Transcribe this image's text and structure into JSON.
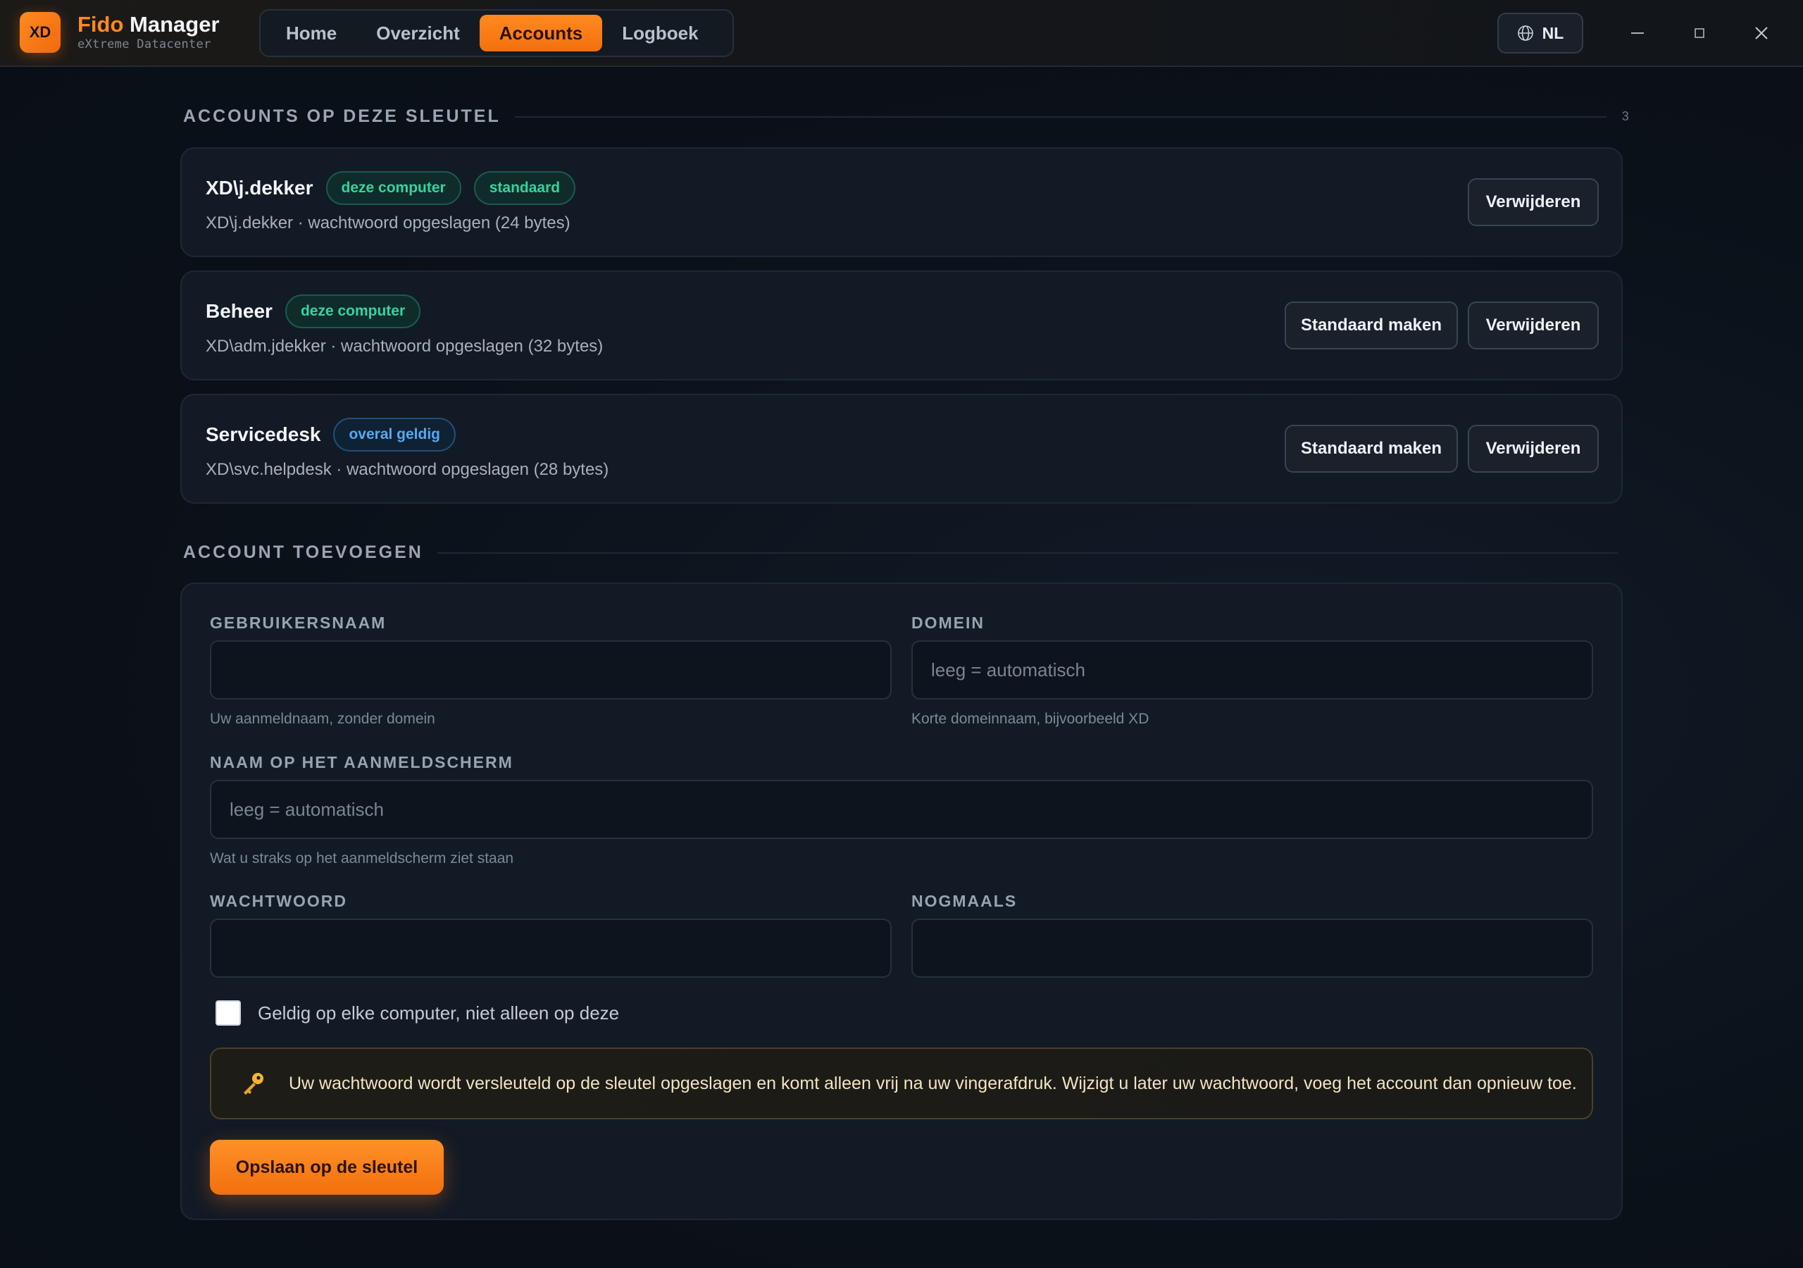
{
  "app": {
    "logo_text": "XD",
    "title_accent": "Fido",
    "title_main": "Manager",
    "subtitle": "eXtreme Datacenter"
  },
  "nav": {
    "tabs": [
      {
        "label": "Home",
        "active": false
      },
      {
        "label": "Overzicht",
        "active": false
      },
      {
        "label": "Accounts",
        "active": true
      },
      {
        "label": "Logboek",
        "active": false
      }
    ]
  },
  "language": {
    "code": "NL",
    "icon": "globe-icon"
  },
  "window_controls": [
    "minimize-icon",
    "maximize-icon",
    "close-icon"
  ],
  "accounts_section": {
    "title": "ACCOUNTS OP DEZE SLEUTEL",
    "count": "3",
    "accounts": [
      {
        "name": "XD\\j.dekker",
        "badges": [
          {
            "label": "deze computer",
            "color": "green"
          },
          {
            "label": "standaard",
            "color": "green"
          }
        ],
        "detail": "XD\\j.dekker · wachtwoord opgeslagen (24 bytes)",
        "make_default_label": null,
        "delete_label": "Verwijderen"
      },
      {
        "name": "Beheer",
        "badges": [
          {
            "label": "deze computer",
            "color": "green"
          }
        ],
        "detail": "XD\\adm.jdekker · wachtwoord opgeslagen (32 bytes)",
        "make_default_label": "Standaard maken",
        "delete_label": "Verwijderen"
      },
      {
        "name": "Servicedesk",
        "badges": [
          {
            "label": "overal geldig",
            "color": "blue"
          }
        ],
        "detail": "XD\\svc.helpdesk · wachtwoord opgeslagen (28 bytes)",
        "make_default_label": "Standaard maken",
        "delete_label": "Verwijderen"
      }
    ]
  },
  "add_section": {
    "title": "ACCOUNT TOEVOEGEN",
    "username": {
      "label": "GEBRUIKERSNAAM",
      "value": "",
      "placeholder": "",
      "hint": "Uw aanmeldnaam, zonder domein"
    },
    "domain": {
      "label": "DOMEIN",
      "value": "",
      "placeholder": "leeg = automatisch",
      "hint": "Korte domeinnaam, bijvoorbeeld XD"
    },
    "display_name": {
      "label": "NAAM OP HET AANMELDSCHERM",
      "value": "",
      "placeholder": "leeg = automatisch",
      "hint": "Wat u straks op het aanmeldscherm ziet staan"
    },
    "password": {
      "label": "WACHTWOORD",
      "value": "",
      "placeholder": ""
    },
    "password_repeat": {
      "label": "NOGMAALS",
      "value": "",
      "placeholder": ""
    },
    "global_checkbox": {
      "label": "Geldig op elke computer, niet alleen op deze",
      "checked": false
    },
    "notice": {
      "icon": "key-icon",
      "text": "Uw wachtwoord wordt versleuteld op de sleutel opgeslagen en komt alleen vrij na uw vingerafdruk. Wijzigt u later uw wachtwoord, voeg het account dan opnieuw toe."
    },
    "save_label": "Opslaan op de sleutel"
  },
  "colors": {
    "accent": "#ff8a1f",
    "badge_green": "#35d39f",
    "badge_blue": "#55a9f2",
    "background": "#0c121b"
  }
}
